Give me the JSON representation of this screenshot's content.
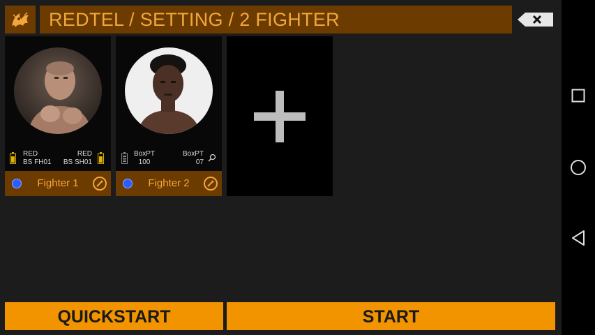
{
  "header": {
    "title": "REDTEL / SETTING / 2 FIGHTER",
    "logo_icon": "dragon-crest-icon",
    "back_icon": "backspace-icon"
  },
  "fighters": [
    {
      "name": "Fighter 1",
      "sensor_left": {
        "line1": "RED",
        "line2": "BS FH01"
      },
      "sensor_right": {
        "line1": "RED",
        "line2": "BS SH01"
      },
      "color": "#2b5cff"
    },
    {
      "name": "Fighter 2",
      "sensor_left": {
        "line1": "BoxPT",
        "line2": "100"
      },
      "sensor_right": {
        "line1": "BoxPT",
        "line2": "07"
      },
      "color": "#2b5cff"
    }
  ],
  "add_card": {
    "icon": "plus-icon"
  },
  "buttons": {
    "quickstart": "QUICKSTART",
    "start": "START"
  },
  "colors": {
    "accent": "#f29400",
    "header_bg": "#6b3b00",
    "text_accent": "#f3a73b",
    "background": "#1c1c1c"
  },
  "system_nav": {
    "recents_icon": "square-icon",
    "home_icon": "circle-icon",
    "back_icon": "triangle-back-icon"
  }
}
